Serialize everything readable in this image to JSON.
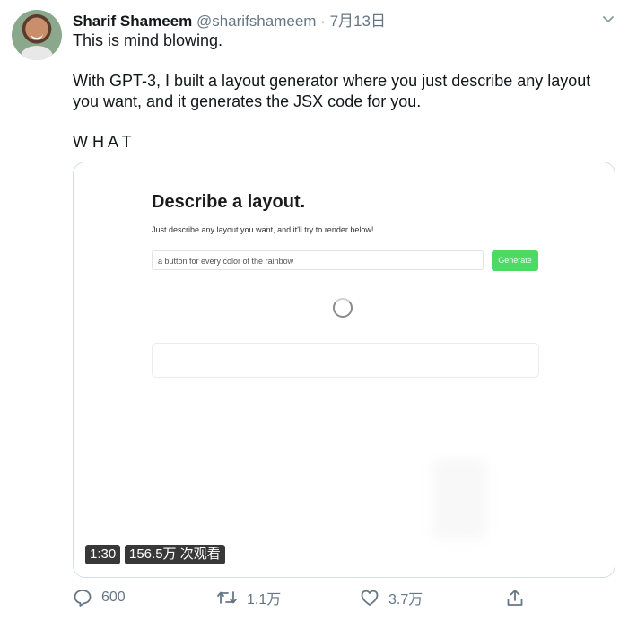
{
  "user": {
    "name": "Sharif Shameem",
    "handle": "@sharifshameem",
    "separator": "·",
    "date": "7月13日"
  },
  "tweet": {
    "lines": [
      "This is mind blowing.",
      "With GPT-3, I built a layout generator where you just describe any layout",
      "you want, and it generates the JSX code for you.",
      "W H A T"
    ]
  },
  "video": {
    "app_title": "Describe a layout.",
    "app_subtitle": "Just describe any layout you want, and it'll try to render below!",
    "input_value": "a button for every color of the rainbow",
    "generate_label": "Generate",
    "duration": "1:30",
    "views": "156.5万 次观看"
  },
  "actions": {
    "replies": "600",
    "retweets": "1.1万",
    "likes": "3.7万"
  },
  "colors": {
    "secondary_text": "#657786",
    "generate_button": "#4cd964"
  },
  "icons": [
    "more-chevron-icon",
    "reply-icon",
    "retweet-icon",
    "like-icon",
    "share-icon"
  ]
}
